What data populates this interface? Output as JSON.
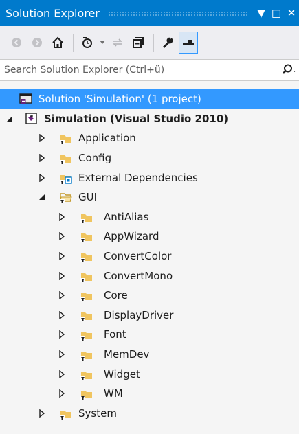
{
  "titlebar": {
    "title": "Solution Explorer",
    "pin_glyph": "▼",
    "maximize_glyph": "□",
    "close_glyph": "✕"
  },
  "toolbar": {
    "buttons": [
      "back-icon",
      "forward-icon",
      "home-icon",
      "pending-changes-filter-icon",
      "dropdown-icon",
      "sync-icon",
      "collapse-all-icon",
      "properties-icon",
      "preview-icon"
    ]
  },
  "search": {
    "placeholder": "Search Solution Explorer (Ctrl+ü)"
  },
  "tree": {
    "solution": {
      "label": "Solution 'Simulation' (1 project)"
    },
    "project": {
      "label": "Simulation (Visual Studio 2010)"
    },
    "folders": [
      {
        "label": "Application"
      },
      {
        "label": "Config"
      },
      {
        "label": "External Dependencies"
      }
    ],
    "gui": {
      "label": "GUI"
    },
    "gui_children": [
      {
        "label": "AntiAlias"
      },
      {
        "label": "AppWizard"
      },
      {
        "label": "ConvertColor"
      },
      {
        "label": "ConvertMono"
      },
      {
        "label": "Core"
      },
      {
        "label": "DisplayDriver"
      },
      {
        "label": "Font"
      },
      {
        "label": "MemDev"
      },
      {
        "label": "Widget"
      },
      {
        "label": "WM"
      }
    ],
    "system": {
      "label": "System"
    }
  },
  "colors": {
    "accent": "#007acc",
    "selection": "#3399ff",
    "folder": "#f0c560",
    "project_purple": "#68217a"
  }
}
